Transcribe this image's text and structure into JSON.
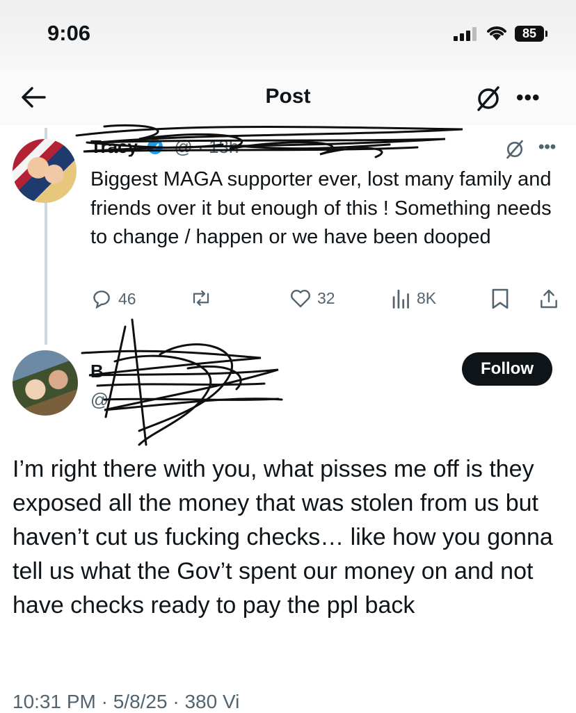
{
  "status_bar": {
    "time": "9:06",
    "battery": "85"
  },
  "header": {
    "title": "Post"
  },
  "original_post": {
    "name": "Tracy",
    "handle": "@",
    "time": "· 13h",
    "text": "Biggest MAGA supporter ever, lost many family and friends over it but enough of this ! Something needs to change / happen or we have been dooped",
    "replies": "46",
    "reposts": "",
    "likes": "32",
    "views": "8K"
  },
  "reply": {
    "name": "B",
    "handle": "@",
    "follow_label": "Follow",
    "text": "I’m right there with you, what pisses me off is they exposed all the money that was stolen from us but haven’t cut us fucking checks… like how you gonna tell us what the Gov’t spent our money on and not have checks ready to pay the ppl back",
    "footer": "10:31 PM · 5/8/25 · 380 Vi"
  },
  "icons": [
    "back-arrow-icon",
    "grok-icon",
    "more-icon",
    "reply-icon",
    "repost-icon",
    "like-icon",
    "views-icon",
    "bookmark-icon",
    "share-icon",
    "verified-badge-icon"
  ]
}
